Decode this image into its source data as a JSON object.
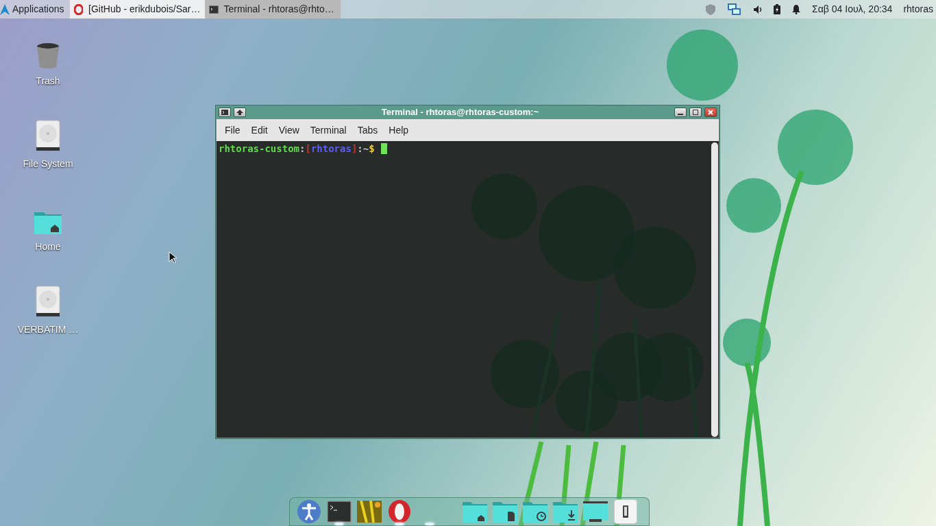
{
  "panel": {
    "menu": "Applications",
    "tasks": [
      {
        "title": "[GitHub - erikdubois/Sar…",
        "kind": "browser",
        "selected": false
      },
      {
        "title": "Terminal - rhtoras@rhto…",
        "kind": "terminal",
        "selected": true
      }
    ],
    "clock": "Σαβ 04 Ιουλ, 20:34",
    "user": "rhtoras"
  },
  "desktop_icons": [
    {
      "label": "Trash",
      "kind": "trash"
    },
    {
      "label": "File System",
      "kind": "drive"
    },
    {
      "label": "Home",
      "kind": "home"
    },
    {
      "label": "VERBATIM …",
      "kind": "drive"
    }
  ],
  "terminal": {
    "title": "Terminal - rhtoras@rhtoras-custom:~",
    "menu": [
      "File",
      "Edit",
      "View",
      "Terminal",
      "Tabs",
      "Help"
    ],
    "prompt": [
      {
        "text": "rhtoras-custom",
        "color": "#5fdc4a"
      },
      {
        "text": ":",
        "color": "#c8c8c8"
      },
      {
        "text": "[",
        "color": "#d22c2c"
      },
      {
        "text": "rhtoras",
        "color": "#5c5cff"
      },
      {
        "text": "]",
        "color": "#d22c2c"
      },
      {
        "text": ":~",
        "color": "#c8c8c8"
      },
      {
        "text": "$",
        "color": "#f2d33c"
      }
    ]
  },
  "dock": [
    {
      "kind": "accessibility",
      "running": false
    },
    {
      "kind": "terminal",
      "running": true
    },
    {
      "kind": "photo",
      "running": false
    },
    {
      "kind": "opera",
      "running": true
    },
    {
      "kind": "hidden",
      "running": true
    },
    {
      "kind": "folder-home",
      "running": false
    },
    {
      "kind": "folder-documents",
      "running": false
    },
    {
      "kind": "folder-recent",
      "running": false
    },
    {
      "kind": "folder-downloads",
      "running": false
    },
    {
      "kind": "desktop",
      "running": false
    },
    {
      "kind": "phone",
      "running": false
    }
  ]
}
